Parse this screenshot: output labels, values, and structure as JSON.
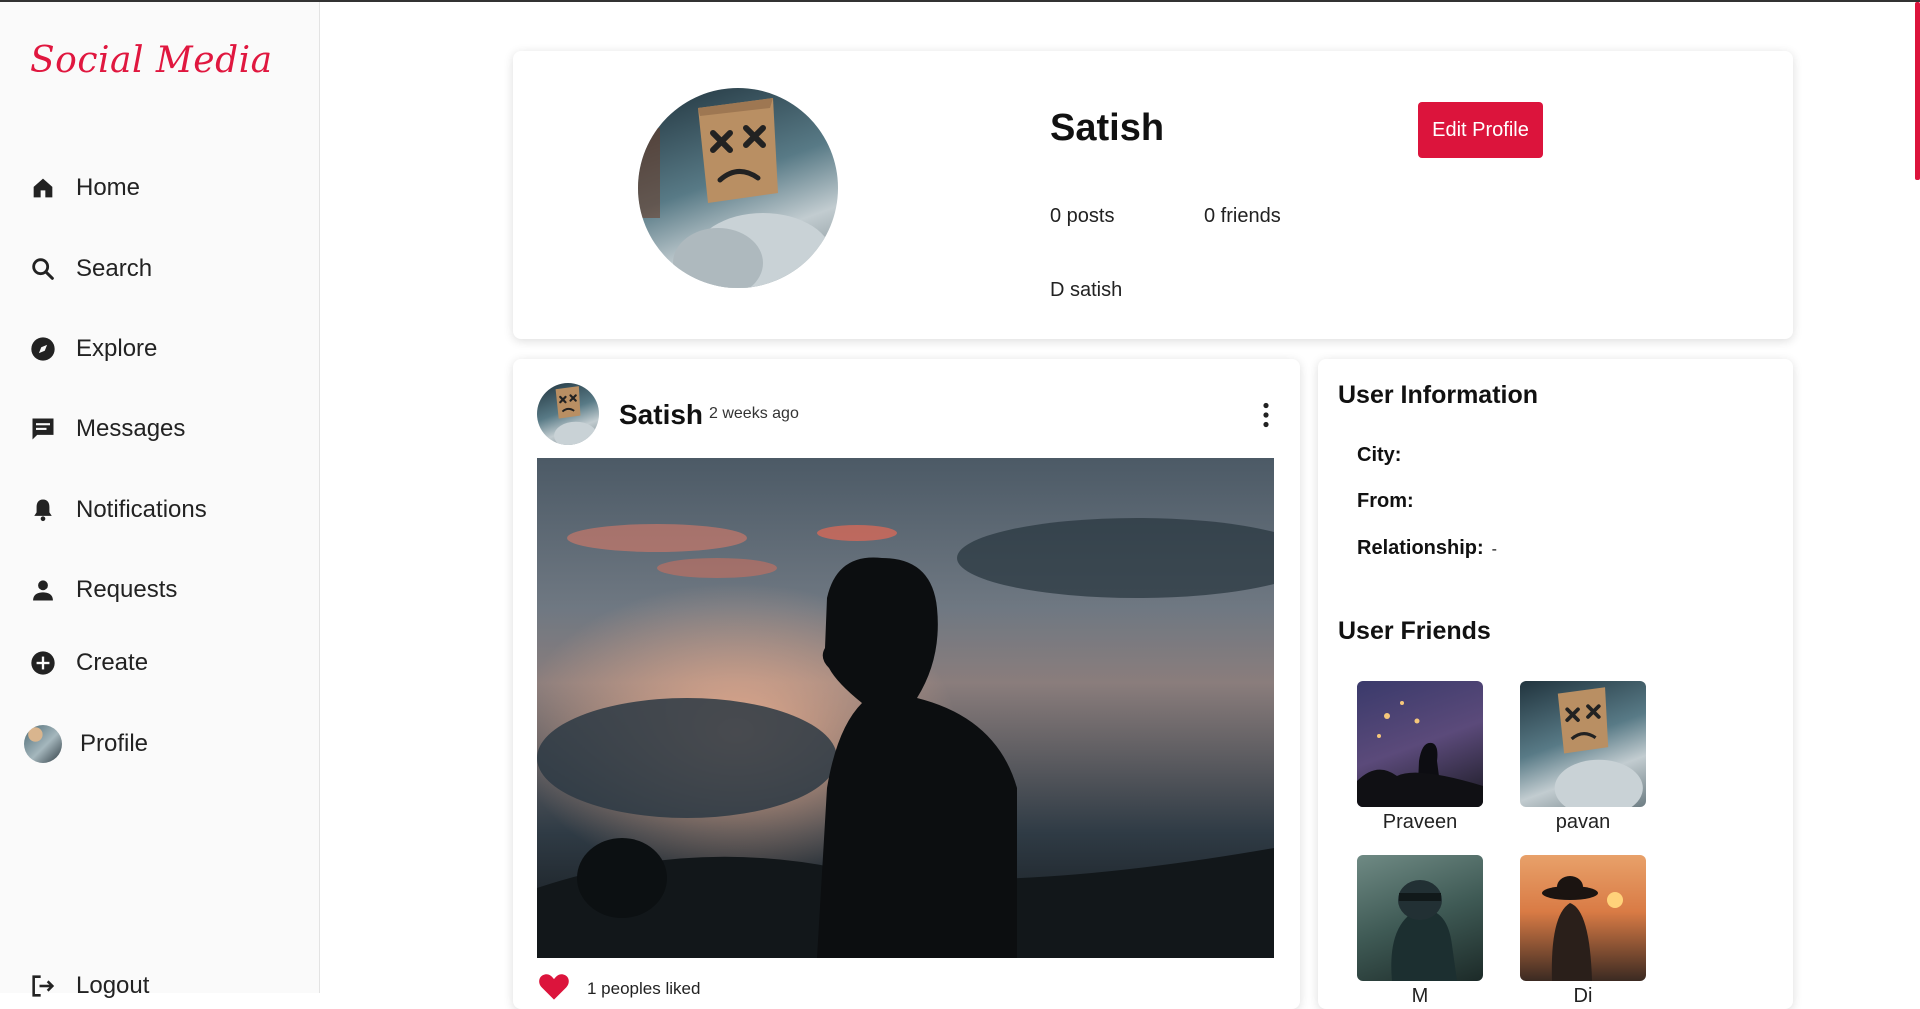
{
  "brand": {
    "name": "Social Media",
    "color": "#e0173f"
  },
  "sidebar": {
    "items": [
      {
        "label": "Home",
        "icon": "home-icon"
      },
      {
        "label": "Search",
        "icon": "search-icon"
      },
      {
        "label": "Explore",
        "icon": "compass-icon"
      },
      {
        "label": "Messages",
        "icon": "message-icon"
      },
      {
        "label": "Notifications",
        "icon": "bell-icon"
      },
      {
        "label": "Requests",
        "icon": "person-icon"
      },
      {
        "label": "Create",
        "icon": "plus-circle-icon"
      },
      {
        "label": "Profile",
        "icon": "avatar"
      },
      {
        "label": "Logout",
        "icon": "logout-icon"
      }
    ]
  },
  "profile": {
    "name": "Satish",
    "edit_label": "Edit Profile",
    "posts": "0 posts",
    "friends": "0 friends",
    "full_name": "D satish",
    "accent": "#dc143c"
  },
  "post": {
    "author": "Satish",
    "time": "2 weeks ago",
    "likes": "1 peoples liked"
  },
  "user_info": {
    "title": "User Information",
    "city_label": "City:",
    "city": "",
    "from_label": "From:",
    "from": "",
    "relationship_label": "Relationship:",
    "relationship": "-"
  },
  "user_friends": {
    "title": "User Friends",
    "friends": [
      {
        "name": "Praveen"
      },
      {
        "name": "pavan"
      },
      {
        "name": "M"
      },
      {
        "name": "Di"
      }
    ]
  }
}
